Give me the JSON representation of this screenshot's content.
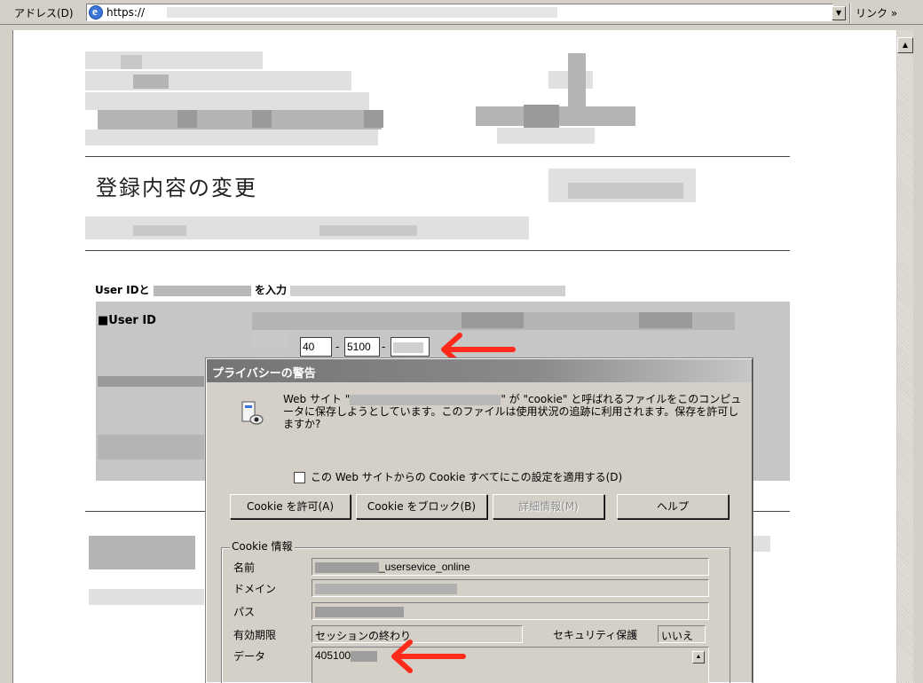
{
  "address_bar": {
    "label": "アドレス(D)",
    "url": "https://",
    "links_label": "リンク »"
  },
  "page": {
    "title": "登録内容の変更",
    "userid_prompt_a": "User IDと",
    "userid_prompt_b": "を入力",
    "userid_label": "■User ID",
    "userid_part1": "40",
    "userid_part2": "5100",
    "dash": "-"
  },
  "dialog": {
    "title": "プライバシーの警告",
    "message_a": "Web サイト \"",
    "message_b": "\" が \"cookie\" と呼ばれるファイルをこのコンピュータに保存しようとしています。このファイルは使用状況の追跡に利用されます。保存を許可しますか?",
    "apply_all_label": "この Web サイトからの Cookie すべてにこの設定を適用する(D)",
    "buttons": {
      "allow": "Cookie を許可(A)",
      "block": "Cookie をブロック(B)",
      "details": "詳細情報(M)",
      "help": "ヘルプ"
    },
    "cookie_info": {
      "group_title": "Cookie 情報",
      "name_label": "名前",
      "name_value": "_usersevice_online",
      "domain_label": "ドメイン",
      "path_label": "パス",
      "expires_label": "有効期限",
      "expires_value": "セッションの終わり",
      "secure_label": "セキュリティ保護",
      "secure_value": "いいえ",
      "data_label": "データ",
      "data_value": "405100"
    }
  },
  "colors": {
    "arrow": "#ff2a1a",
    "titlebar": "#747474"
  },
  "icons": [
    "ie-icon",
    "dropdown-arrow-icon",
    "scroll-up-icon",
    "privacy-eye-icon",
    "red-arrow-icon"
  ]
}
